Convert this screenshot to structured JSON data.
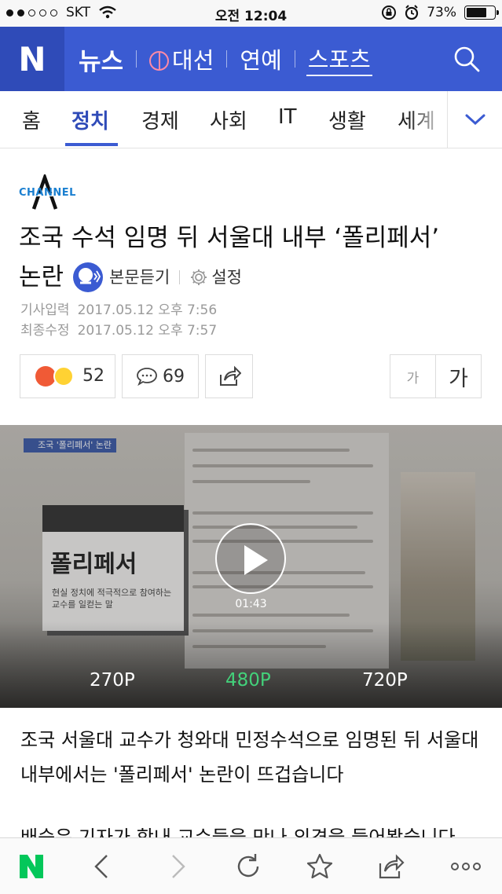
{
  "status_bar": {
    "carrier": "SKT",
    "time": "오전 12:04",
    "battery": "73%",
    "battery_level": 0.73
  },
  "nav": {
    "logo": "N",
    "items": [
      "뉴스",
      "대선",
      "연예",
      "스포츠"
    ]
  },
  "tabs": {
    "items": [
      "홈",
      "정치",
      "경제",
      "사회",
      "IT",
      "생활",
      "세계"
    ],
    "active": "정치"
  },
  "article": {
    "press": "CHANNEL",
    "title_line1": "조국 수석 임명 뒤 서울대 내부 ‘폴리페서’",
    "title_line2": "논란",
    "listen_label": "본문듣기",
    "setting_label": "설정",
    "published_label": "기사입력",
    "published": "2017.05.12 오후 7:56",
    "modified_label": "최종수정",
    "modified": "2017.05.12 오후 7:57",
    "reaction_count": "52",
    "comment_count": "69",
    "font_small": "가",
    "font_large": "가"
  },
  "video": {
    "tag": "조국 '폴리페서' 논란",
    "card_title": "폴리페서",
    "card_sub": "현실 정치에 적극적으로 참여하는 교수를 일컫는 말",
    "duration": "01:43",
    "qualities": [
      "270P",
      "480P",
      "720P"
    ],
    "selected_quality": "480P"
  },
  "body": {
    "paragraph": "조국 서울대 교수가 청와대 민정수석으로 임명된 뒤 서울대 내부에서는 '폴리페서' 논란이 뜨겁습니다",
    "cut_line": "배승은 기자가 학내 교수들을 만나 의견을 들어봤습니다."
  },
  "colors": {
    "brand": "#3b5bd2",
    "brand_dark": "#2f4bb8",
    "naver_green": "#03c75a",
    "quality_active": "#43d17a"
  },
  "icons": [
    "wifi-icon",
    "lock-rotation-icon",
    "alarm-icon",
    "battery-icon",
    "search-icon",
    "chevron-down-icon",
    "listen-icon",
    "gear-icon",
    "comment-icon",
    "share-icon",
    "play-icon",
    "back-icon",
    "forward-icon",
    "refresh-icon",
    "star-icon",
    "more-icon"
  ]
}
